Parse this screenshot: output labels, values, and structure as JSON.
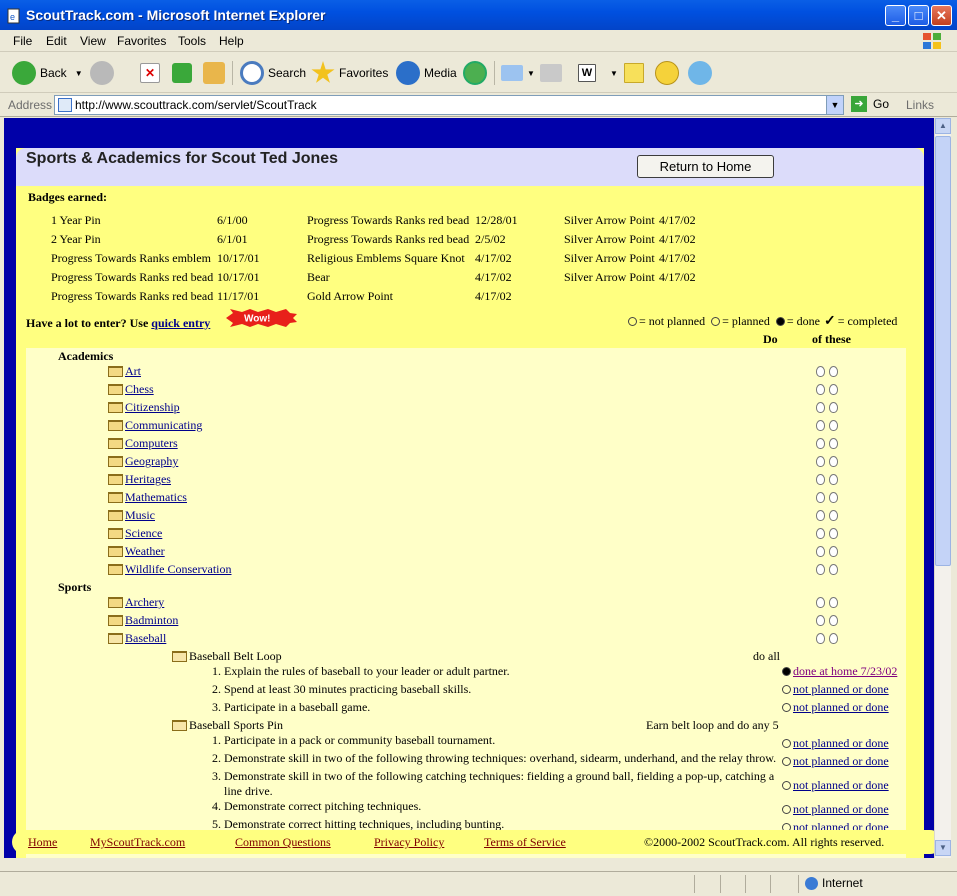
{
  "window": {
    "title": "ScoutTrack.com - Microsoft Internet Explorer"
  },
  "menu": [
    "File",
    "Edit",
    "View",
    "Favorites",
    "Tools",
    "Help"
  ],
  "toolbar": {
    "back": "Back",
    "search": "Search",
    "favorites": "Favorites",
    "media": "Media"
  },
  "address": {
    "label": "Address",
    "url": "http://www.scouttrack.com/servlet/ScoutTrack",
    "go": "Go",
    "links": "Links"
  },
  "page": {
    "heading": "Sports & Academics for Scout Ted Jones",
    "return_button": "Return to Home",
    "badges_label": "Badges earned:",
    "badges": [
      {
        "name": "1 Year Pin",
        "date": "6/1/00"
      },
      {
        "name": "2 Year Pin",
        "date": "6/1/01"
      },
      {
        "name": "Progress Towards Ranks emblem",
        "date": "10/17/01"
      },
      {
        "name": "Progress Towards Ranks red bead",
        "date": "10/17/01"
      },
      {
        "name": "Progress Towards Ranks red bead",
        "date": "11/17/01"
      },
      {
        "name": "Progress Towards Ranks red bead",
        "date": "12/28/01"
      },
      {
        "name": "Progress Towards Ranks red bead",
        "date": "2/5/02"
      },
      {
        "name": "Religious Emblems Square Knot",
        "date": "4/17/02"
      },
      {
        "name": "Bear",
        "date": "4/17/02"
      },
      {
        "name": "Gold Arrow Point",
        "date": "4/17/02"
      },
      {
        "name": "Silver Arrow Point",
        "date": "4/17/02"
      },
      {
        "name": "Silver Arrow Point",
        "date": "4/17/02"
      },
      {
        "name": "Silver Arrow Point",
        "date": "4/17/02"
      },
      {
        "name": "Silver Arrow Point",
        "date": "4/17/02"
      }
    ],
    "entry_prefix": "Have a lot to enter? Use",
    "entry_link": "quick entry",
    "wow": "Wow!",
    "legend": {
      "not_planned": "= not planned",
      "planned": "= planned",
      "done": "= done",
      "completed": "= completed"
    },
    "col_do": "Do",
    "col_of": "of these",
    "academics_label": "Academics",
    "academics": [
      "Art",
      "Chess",
      "Citizenship",
      "Communicating",
      "Computers",
      "Geography",
      "Heritages",
      "Mathematics",
      "Music",
      "Science",
      "Weather",
      "Wildlife Conservation"
    ],
    "sports_label": "Sports",
    "sports": [
      "Archery",
      "Badminton",
      "Baseball"
    ],
    "belt_loop": {
      "title": "Baseball Belt Loop",
      "do": "do all",
      "reqs": [
        {
          "text": "1. Explain the rules of baseball to your leader or adult partner.",
          "status": "done at home 7/23/02"
        },
        {
          "text": "2. Spend at least 30 minutes practicing baseball skills.",
          "status": "not planned or done"
        },
        {
          "text": "3. Participate in a baseball game.",
          "status": "not planned or done"
        }
      ]
    },
    "sports_pin": {
      "title": "Baseball Sports Pin",
      "do": "Earn belt loop and do any 5",
      "reqs": [
        {
          "text": "1. Participate in a pack or community baseball tournament.",
          "status": "not planned or done"
        },
        {
          "text": "2. Demonstrate skill in two of the following throwing techniques: overhand, sidearm, underhand, and the relay throw.",
          "status": "not planned or done"
        },
        {
          "text": "3. Demonstrate skill in two of the following catching techniques: fielding a ground ball, fielding a pop-up, catching a",
          "text2": "line drive.",
          "status": "not planned or done"
        },
        {
          "text": "4. Demonstrate correct pitching techniques.",
          "status": "not planned or done"
        },
        {
          "text": "5. Demonstrate correct hitting techniques, including bunting.",
          "status": "not planned or done"
        }
      ]
    },
    "footer": {
      "links": [
        "Home",
        "MyScoutTrack.com",
        "Common Questions",
        "Privacy Policy",
        "Terms of Service"
      ],
      "copyright": "©2000-2002 ScoutTrack.com. All rights reserved."
    }
  },
  "statusbar": {
    "zone": "Internet"
  }
}
